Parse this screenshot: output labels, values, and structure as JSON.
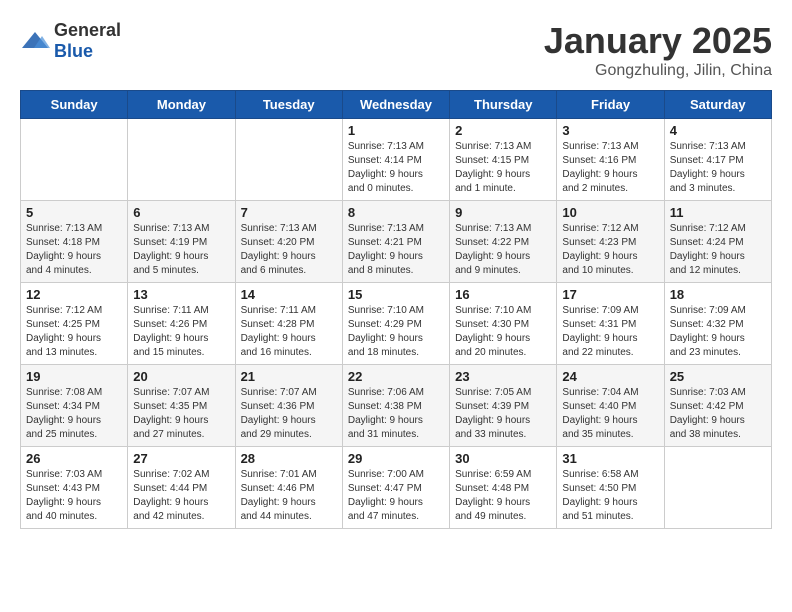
{
  "header": {
    "logo_general": "General",
    "logo_blue": "Blue",
    "month_title": "January 2025",
    "location": "Gongzhuling, Jilin, China"
  },
  "weekdays": [
    "Sunday",
    "Monday",
    "Tuesday",
    "Wednesday",
    "Thursday",
    "Friday",
    "Saturday"
  ],
  "weeks": [
    [
      {
        "day": "",
        "details": ""
      },
      {
        "day": "",
        "details": ""
      },
      {
        "day": "",
        "details": ""
      },
      {
        "day": "1",
        "details": "Sunrise: 7:13 AM\nSunset: 4:14 PM\nDaylight: 9 hours\nand 0 minutes."
      },
      {
        "day": "2",
        "details": "Sunrise: 7:13 AM\nSunset: 4:15 PM\nDaylight: 9 hours\nand 1 minute."
      },
      {
        "day": "3",
        "details": "Sunrise: 7:13 AM\nSunset: 4:16 PM\nDaylight: 9 hours\nand 2 minutes."
      },
      {
        "day": "4",
        "details": "Sunrise: 7:13 AM\nSunset: 4:17 PM\nDaylight: 9 hours\nand 3 minutes."
      }
    ],
    [
      {
        "day": "5",
        "details": "Sunrise: 7:13 AM\nSunset: 4:18 PM\nDaylight: 9 hours\nand 4 minutes."
      },
      {
        "day": "6",
        "details": "Sunrise: 7:13 AM\nSunset: 4:19 PM\nDaylight: 9 hours\nand 5 minutes."
      },
      {
        "day": "7",
        "details": "Sunrise: 7:13 AM\nSunset: 4:20 PM\nDaylight: 9 hours\nand 6 minutes."
      },
      {
        "day": "8",
        "details": "Sunrise: 7:13 AM\nSunset: 4:21 PM\nDaylight: 9 hours\nand 8 minutes."
      },
      {
        "day": "9",
        "details": "Sunrise: 7:13 AM\nSunset: 4:22 PM\nDaylight: 9 hours\nand 9 minutes."
      },
      {
        "day": "10",
        "details": "Sunrise: 7:12 AM\nSunset: 4:23 PM\nDaylight: 9 hours\nand 10 minutes."
      },
      {
        "day": "11",
        "details": "Sunrise: 7:12 AM\nSunset: 4:24 PM\nDaylight: 9 hours\nand 12 minutes."
      }
    ],
    [
      {
        "day": "12",
        "details": "Sunrise: 7:12 AM\nSunset: 4:25 PM\nDaylight: 9 hours\nand 13 minutes."
      },
      {
        "day": "13",
        "details": "Sunrise: 7:11 AM\nSunset: 4:26 PM\nDaylight: 9 hours\nand 15 minutes."
      },
      {
        "day": "14",
        "details": "Sunrise: 7:11 AM\nSunset: 4:28 PM\nDaylight: 9 hours\nand 16 minutes."
      },
      {
        "day": "15",
        "details": "Sunrise: 7:10 AM\nSunset: 4:29 PM\nDaylight: 9 hours\nand 18 minutes."
      },
      {
        "day": "16",
        "details": "Sunrise: 7:10 AM\nSunset: 4:30 PM\nDaylight: 9 hours\nand 20 minutes."
      },
      {
        "day": "17",
        "details": "Sunrise: 7:09 AM\nSunset: 4:31 PM\nDaylight: 9 hours\nand 22 minutes."
      },
      {
        "day": "18",
        "details": "Sunrise: 7:09 AM\nSunset: 4:32 PM\nDaylight: 9 hours\nand 23 minutes."
      }
    ],
    [
      {
        "day": "19",
        "details": "Sunrise: 7:08 AM\nSunset: 4:34 PM\nDaylight: 9 hours\nand 25 minutes."
      },
      {
        "day": "20",
        "details": "Sunrise: 7:07 AM\nSunset: 4:35 PM\nDaylight: 9 hours\nand 27 minutes."
      },
      {
        "day": "21",
        "details": "Sunrise: 7:07 AM\nSunset: 4:36 PM\nDaylight: 9 hours\nand 29 minutes."
      },
      {
        "day": "22",
        "details": "Sunrise: 7:06 AM\nSunset: 4:38 PM\nDaylight: 9 hours\nand 31 minutes."
      },
      {
        "day": "23",
        "details": "Sunrise: 7:05 AM\nSunset: 4:39 PM\nDaylight: 9 hours\nand 33 minutes."
      },
      {
        "day": "24",
        "details": "Sunrise: 7:04 AM\nSunset: 4:40 PM\nDaylight: 9 hours\nand 35 minutes."
      },
      {
        "day": "25",
        "details": "Sunrise: 7:03 AM\nSunset: 4:42 PM\nDaylight: 9 hours\nand 38 minutes."
      }
    ],
    [
      {
        "day": "26",
        "details": "Sunrise: 7:03 AM\nSunset: 4:43 PM\nDaylight: 9 hours\nand 40 minutes."
      },
      {
        "day": "27",
        "details": "Sunrise: 7:02 AM\nSunset: 4:44 PM\nDaylight: 9 hours\nand 42 minutes."
      },
      {
        "day": "28",
        "details": "Sunrise: 7:01 AM\nSunset: 4:46 PM\nDaylight: 9 hours\nand 44 minutes."
      },
      {
        "day": "29",
        "details": "Sunrise: 7:00 AM\nSunset: 4:47 PM\nDaylight: 9 hours\nand 47 minutes."
      },
      {
        "day": "30",
        "details": "Sunrise: 6:59 AM\nSunset: 4:48 PM\nDaylight: 9 hours\nand 49 minutes."
      },
      {
        "day": "31",
        "details": "Sunrise: 6:58 AM\nSunset: 4:50 PM\nDaylight: 9 hours\nand 51 minutes."
      },
      {
        "day": "",
        "details": ""
      }
    ]
  ]
}
